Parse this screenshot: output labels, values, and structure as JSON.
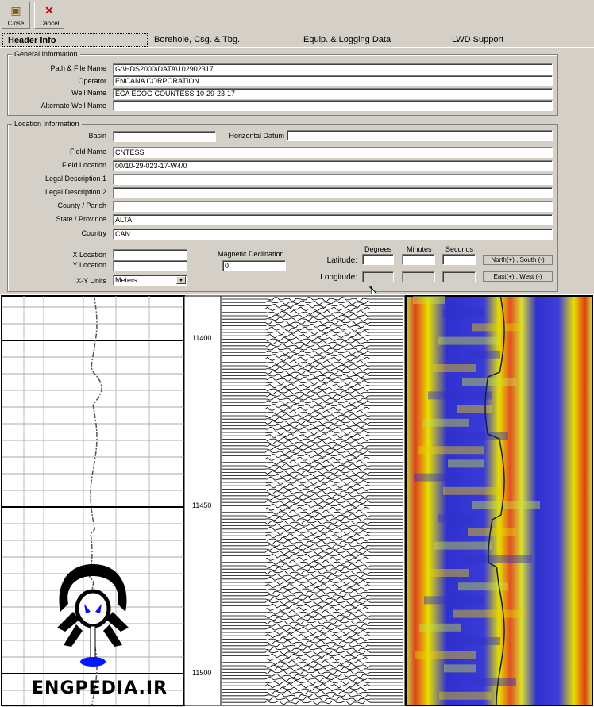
{
  "toolbar": {
    "close_label": "Close",
    "cancel_label": "Cancel"
  },
  "tabs": [
    {
      "label": "Header Info",
      "active": true
    },
    {
      "label": "Borehole, Csg. & Tbg."
    },
    {
      "label": "Equip. & Logging Data"
    },
    {
      "label": "LWD Support"
    }
  ],
  "general": {
    "title": "General Information",
    "path_label": "Path & File Name",
    "path_value": "G:\\HDS2000\\DATA\\102902317",
    "operator_label": "Operator",
    "operator_value": "ENCANA CORPORATION",
    "well_label": "Well Name",
    "well_value": "ECA ECOG COUNTESS 10-29-23-17",
    "alt_label": "Alternate Well Name",
    "alt_value": ""
  },
  "location": {
    "title": "Location Information",
    "basin_label": "Basin",
    "basin_value": "",
    "datum_label": "Horizontal Datum",
    "datum_value": "",
    "field_name_label": "Field Name",
    "field_name_value": "CNTESS",
    "field_loc_label": "Field Location",
    "field_loc_value": "00/10-29-023-17-W4/0",
    "legal1_label": "Legal Description 1",
    "legal2_label": "Legal Description 2",
    "county_label": "County / Parish",
    "state_label": "State / Province",
    "state_value": "ALTA",
    "country_label": "Country",
    "country_value": "CAN",
    "x_label": "X Location",
    "y_label": "Y Location",
    "xy_units_label": "X-Y Units",
    "xy_units_value": "Meters",
    "mag_label": "Magnetic Declination",
    "mag_value": "0",
    "degrees_label": "Degrees",
    "minutes_label": "Minutes",
    "seconds_label": "Seconds",
    "lat_label": "Latitude:",
    "lon_label": "Longitude:",
    "ns_label": "North(+) , South (-)",
    "ew_label": "East(+) , West (-)"
  },
  "log": {
    "depths": [
      "11400",
      "11450",
      "11500"
    ]
  },
  "watermark": "ENGPEDIA.IR",
  "colors": {
    "accent": "#0000cc",
    "heat_low": "#2a2fd0",
    "heat_high": "#e03010",
    "heat_mid": "#e8e000"
  }
}
